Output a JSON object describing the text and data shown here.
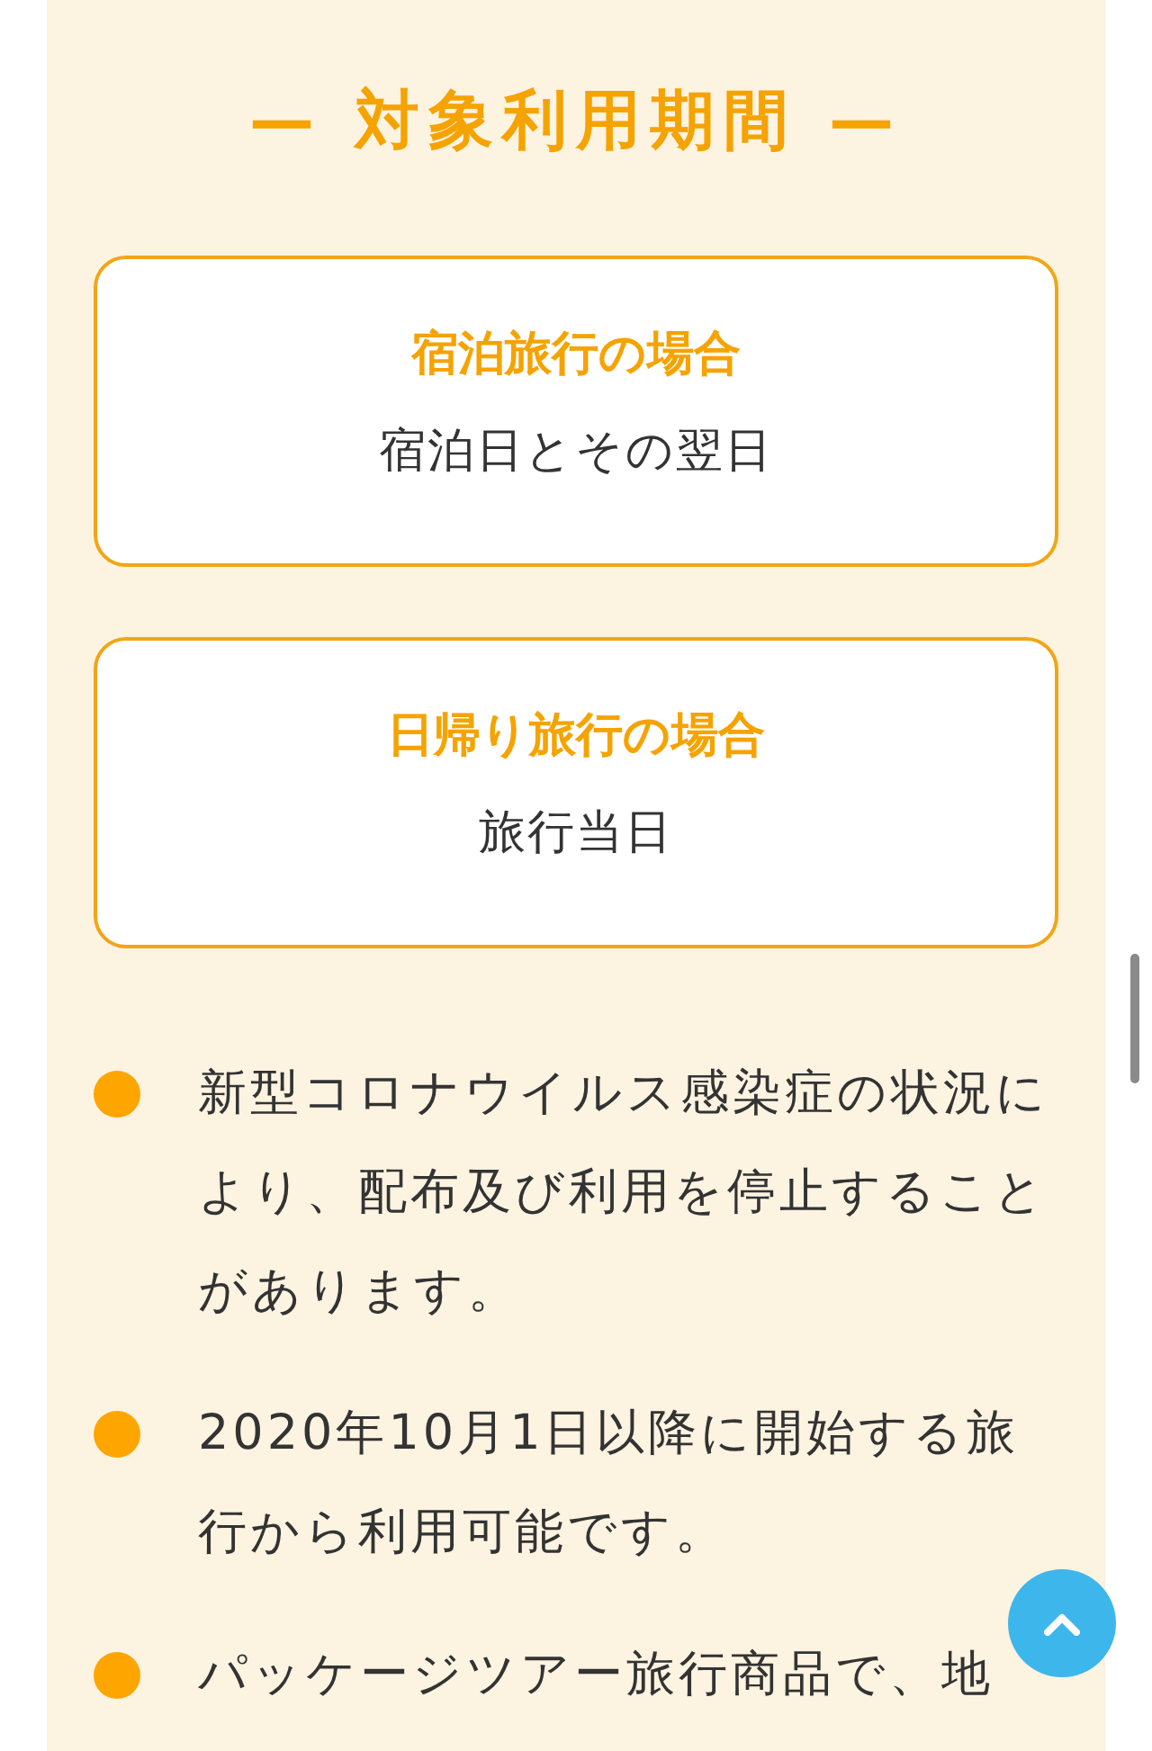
{
  "section_title": "— 対象利用期間 —",
  "periods": [
    {
      "heading": "宿泊旅行の場合",
      "detail": "宿泊日とその翌日"
    },
    {
      "heading": "日帰り旅行の場合",
      "detail": "旅行当日"
    }
  ],
  "notes": [
    "新型コロナウイルス感染症の状況により、配布及び利用を停止することがあります。",
    "2020年10月1日以降に開始する旅行から利用可能です。",
    "パッケージツアー旅行商品で、地"
  ]
}
